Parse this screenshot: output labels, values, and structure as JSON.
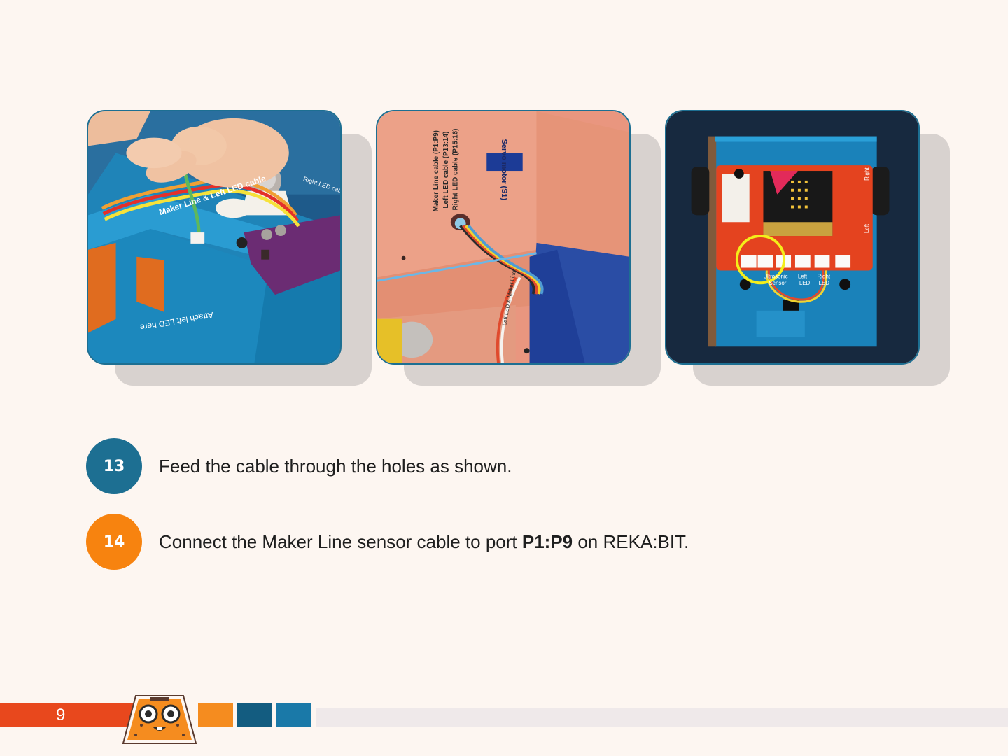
{
  "steps": [
    {
      "number": "13",
      "text": "Feed the cable through the holes as shown.",
      "color": "#1d6f92"
    },
    {
      "number": "14",
      "text_before": "Connect the Maker Line sensor cable to port ",
      "text_bold": "P1:P9",
      "text_after": " on REKA:BIT.",
      "color": "#f7830f"
    }
  ],
  "photos": {
    "photo1": {
      "box_label": "Maker Line & Left LED cable",
      "side_label": "Attach left LED here",
      "corner_label": "Right LED cable"
    },
    "photo2": {
      "servo_label": "Servo motor (S1)",
      "cable_label_1": "Maker Line cable (P1:P9)",
      "cable_label_2": "Left LED cable (P13:14)",
      "cable_label_3": "Right LED cable (P15:16)",
      "bottom_label": "Left LED & Maker Line"
    },
    "photo3": {
      "port_label_1": "Ultrasonic",
      "port_label_2": "Sensor",
      "port_label_3": "Left",
      "port_label_4": "LED",
      "port_label_5": "Right",
      "port_label_6": "LED",
      "side_label_right": "Right",
      "side_label_left": "Left",
      "highlight_color": "#f4ee1a"
    }
  },
  "footer": {
    "page_number": "9",
    "colors": {
      "red": "#e8481d",
      "orange": "#f58c1f",
      "dark_blue": "#135c80",
      "blue": "#1a79a8",
      "gray": "#efe9ea"
    }
  }
}
